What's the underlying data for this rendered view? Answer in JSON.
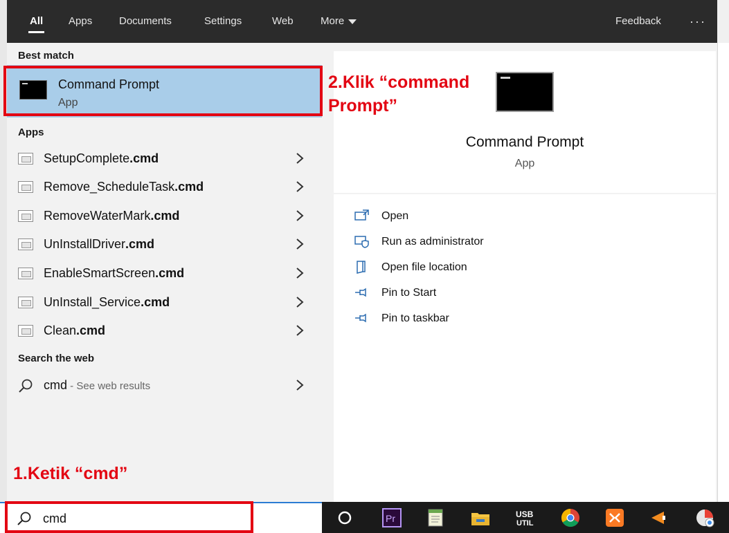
{
  "tabs": [
    {
      "label": "All",
      "active": true
    },
    {
      "label": "Apps",
      "active": false
    },
    {
      "label": "Documents",
      "active": false
    },
    {
      "label": "Settings",
      "active": false
    },
    {
      "label": "Web",
      "active": false
    },
    {
      "label": "More",
      "active": false
    }
  ],
  "header": {
    "feedback_label": "Feedback",
    "overflow_label": "···"
  },
  "best_match": {
    "section_label": "Best match",
    "title": "Command Prompt",
    "subtitle": "App"
  },
  "apps": {
    "section_label": "Apps",
    "items": [
      {
        "name": "SetupComplete",
        "ext": ".cmd"
      },
      {
        "name": "Remove_ScheduleTask",
        "ext": ".cmd"
      },
      {
        "name": "RemoveWaterMark",
        "ext": ".cmd"
      },
      {
        "name": "UnInstallDriver",
        "ext": ".cmd"
      },
      {
        "name": "EnableSmartScreen",
        "ext": ".cmd"
      },
      {
        "name": "UnInstall_Service",
        "ext": ".cmd"
      },
      {
        "name": "Clean",
        "ext": ".cmd"
      }
    ]
  },
  "search_web": {
    "section_label": "Search the web",
    "query": "cmd",
    "suffix": " - See web results"
  },
  "preview": {
    "title": "Command Prompt",
    "subtitle": "App"
  },
  "actions": [
    {
      "label": "Open",
      "icon": "open-icon"
    },
    {
      "label": "Run as administrator",
      "icon": "shield-icon"
    },
    {
      "label": "Open file location",
      "icon": "folder-icon"
    },
    {
      "label": "Pin to Start",
      "icon": "pin-icon"
    },
    {
      "label": "Pin to taskbar",
      "icon": "pin-icon"
    }
  ],
  "search_box": {
    "value": "cmd"
  },
  "taskbar_icons": [
    "cortana-icon",
    "premiere-icon",
    "notepad-icon",
    "file-explorer-icon",
    "usb-util-icon",
    "chrome-icon",
    "xampp-icon",
    "vlc-icon",
    "browser-icon"
  ],
  "annotations": {
    "step1": "1.Ketik “cmd”",
    "step2_line1": "2.Klik “command",
    "step2_line2": "Prompt”"
  },
  "colors": {
    "accent": "#a9cde9",
    "annotation": "#e30613",
    "topbar": "#2b2b2b",
    "taskbar": "#1a1a1a"
  }
}
